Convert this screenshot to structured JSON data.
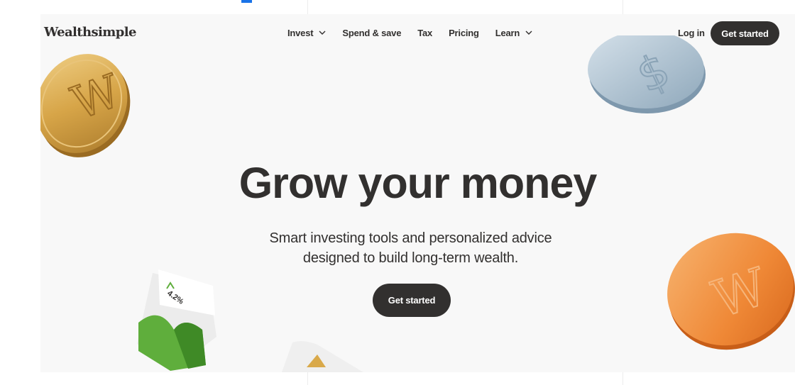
{
  "nav": {
    "logo": "Wealthsimple",
    "items": [
      {
        "label": "Invest",
        "has_dropdown": true
      },
      {
        "label": "Spend & save",
        "has_dropdown": false
      },
      {
        "label": "Tax",
        "has_dropdown": false
      },
      {
        "label": "Pricing",
        "has_dropdown": false
      },
      {
        "label": "Learn",
        "has_dropdown": true
      }
    ],
    "login_label": "Log in",
    "cta_label": "Get started"
  },
  "hero": {
    "title": "Grow your money",
    "subtitle_line1": "Smart investing tools and personalized advice",
    "subtitle_line2": "designed to build long-term wealth.",
    "cta_label": "Get started"
  },
  "decorations": {
    "gold_coin_letter": "W",
    "orange_coin_letter": "W",
    "silver_coin_symbol": "$",
    "growth_badge": "4.2%"
  },
  "colors": {
    "text_dark": "#32302f",
    "button_dark": "#32302f",
    "background": "#f8f8f8",
    "gold_coin": "#d9a94a",
    "orange_coin": "#f0893a",
    "silver_coin": "#a9bfd0",
    "green_block": "#5fae3c"
  },
  "icons": {
    "dropdown": "chevron-down-icon",
    "trend": "arrow-up-icon"
  }
}
